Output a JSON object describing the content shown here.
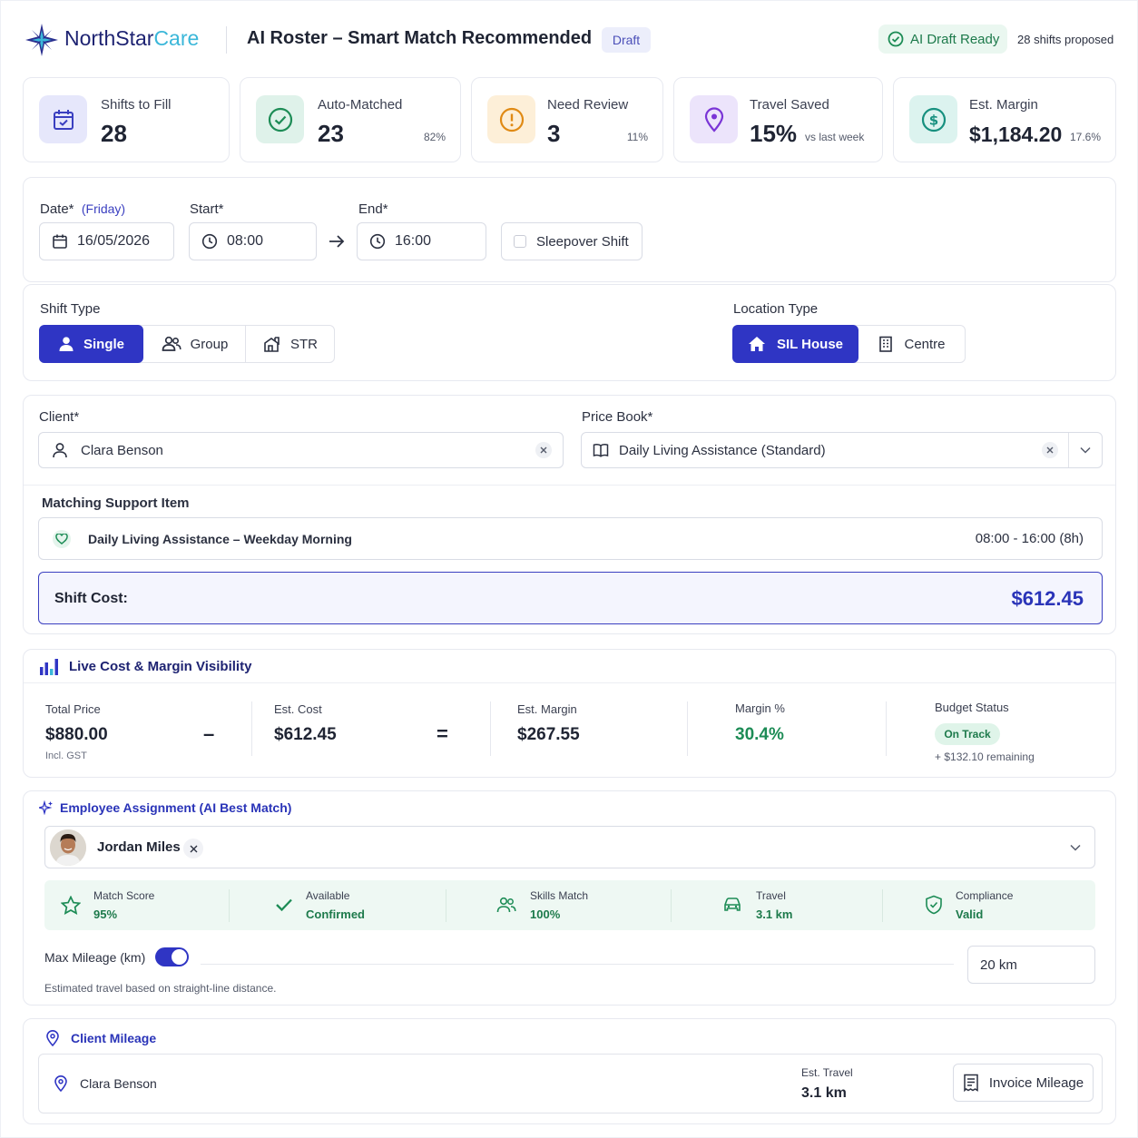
{
  "brand": {
    "name_a": "NorthStar",
    "name_b": "Care"
  },
  "header": {
    "title": "AI Roster – Smart Match Recommended",
    "badge": "Draft",
    "ready": "AI Draft Ready",
    "proposed": "28 shifts proposed"
  },
  "stats": [
    {
      "title": "Shifts to Fill",
      "value": "28",
      "pct": ""
    },
    {
      "title": "Auto-Matched",
      "value": "23",
      "pct": "82%"
    },
    {
      "title": "Need Review",
      "value": "3",
      "pct": "11%"
    },
    {
      "title": "Travel Saved",
      "value": "15%",
      "pct": "vs last week"
    },
    {
      "title": "Est. Margin",
      "value": "$1,184.20",
      "pct": "17.6%"
    }
  ],
  "datetime": {
    "date_label": "Date*",
    "date_day": "(Friday)",
    "date_value": "16/05/2026",
    "start_label": "Start*",
    "start_value": "08:00",
    "end_label": "End*",
    "end_value": "16:00",
    "sleepover": "Sleepover Shift"
  },
  "shift_type": {
    "label": "Shift Type",
    "options": [
      "Single",
      "Group",
      "STR"
    ]
  },
  "location_type": {
    "label": "Location Type",
    "options": [
      "SIL House",
      "Centre"
    ]
  },
  "client": {
    "label": "Client*",
    "value": "Clara Benson"
  },
  "price_book": {
    "label": "Price Book*",
    "value": "Daily Living Assistance (Standard)"
  },
  "support": {
    "label": "Matching Support Item",
    "item": "Daily Living Assistance – Weekday Morning",
    "time": "08:00 - 16:00 (8h)",
    "cost_label": "Shift Cost:",
    "cost_value": "$612.45"
  },
  "margin": {
    "title": "Live Cost & Margin Visibility",
    "total_label": "Total Price",
    "total_value": "$880.00",
    "total_note": "Incl. GST",
    "minus": "–",
    "cost_label": "Est. Cost",
    "cost_value": "$612.45",
    "equals": "=",
    "margin_label": "Est. Margin",
    "margin_value": "$267.55",
    "pct_label": "Margin %",
    "pct_value": "30.4%",
    "budget_label": "Budget Status",
    "budget_badge": "On Track",
    "budget_note": "+ $132.10 remaining"
  },
  "employee": {
    "title": "Employee Assignment (AI Best Match)",
    "name": "Jordan Miles",
    "metrics": [
      {
        "label": "Match Score",
        "value": "95%"
      },
      {
        "label": "Available",
        "value": "Confirmed"
      },
      {
        "label": "Skills Match",
        "value": "100%"
      },
      {
        "label": "Travel",
        "value": "3.1 km"
      },
      {
        "label": "Compliance",
        "value": "Valid"
      }
    ],
    "mileage_label": "Max Mileage (km)",
    "mileage_value": "20 km",
    "toggle_on": true,
    "note": "Estimated travel based on straight-line distance."
  },
  "client_mileage": {
    "title": "Client Mileage",
    "client": "Clara Benson",
    "travel_label": "Est. Travel",
    "travel_value": "3.1 km",
    "invoice_btn": "Invoice Mileage"
  },
  "colors": {
    "primary": "#2f35c4",
    "green": "#1d8c56",
    "green_bg": "#eef8f3"
  }
}
